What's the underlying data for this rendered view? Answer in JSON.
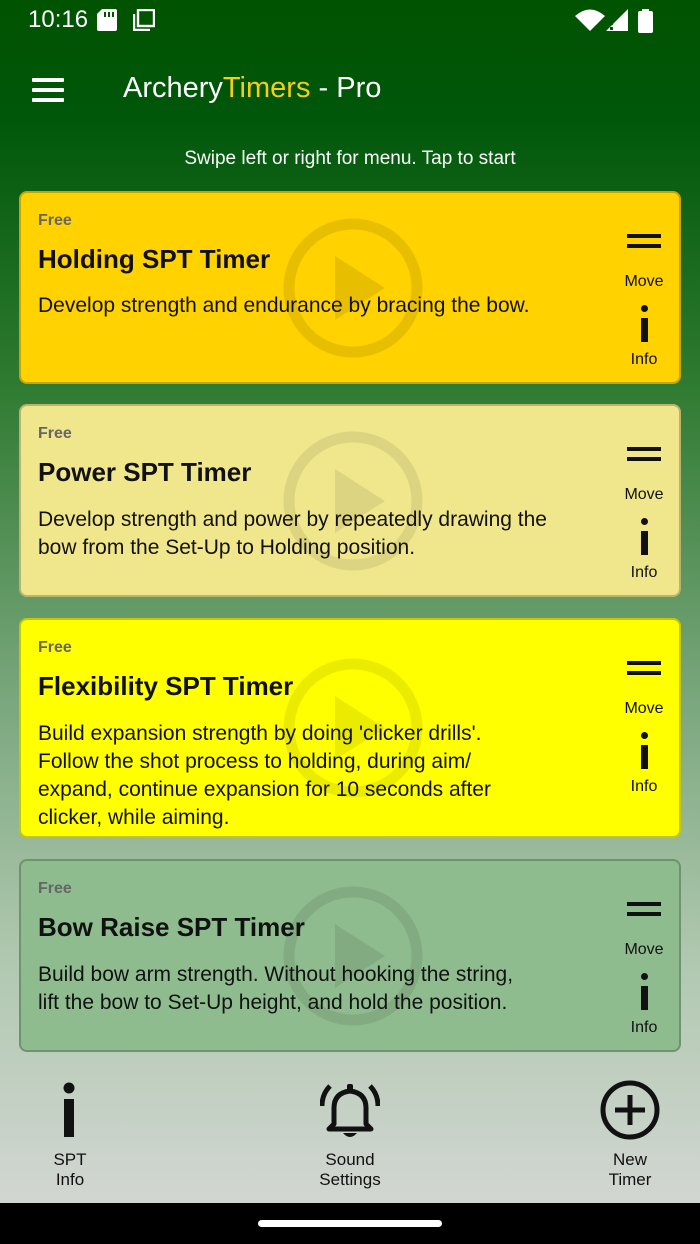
{
  "status_bar": {
    "time": "10:16",
    "icons": [
      "sd-card-icon",
      "screenshot-icon",
      "wifi-icon",
      "signal-icon",
      "battery-icon"
    ]
  },
  "app_bar": {
    "title_part1": "Archery",
    "title_part2": "Timers",
    "title_part3": " - Pro",
    "accent_color": "#f5cc16"
  },
  "hint": "Swipe left or right for menu. Tap to start",
  "cards": [
    {
      "badge": "Free",
      "title": "Holding SPT Timer",
      "desc_lines": [
        "Develop strength and endurance by bracing the bow."
      ],
      "move_label": "Move",
      "info_label": "Info",
      "color": "#ffd200"
    },
    {
      "badge": "Free",
      "title": "Power SPT Timer",
      "desc_lines": [
        "Develop strength and power by repeatedly drawing the",
        "bow from the Set-Up to Holding position."
      ],
      "move_label": "Move",
      "info_label": "Info",
      "color": "#f0e68c"
    },
    {
      "badge": "Free",
      "title": "Flexibility SPT Timer",
      "desc_lines": [
        "Build expansion strength by doing 'clicker drills'.",
        "Follow the shot process to holding, during aim/",
        "expand, continue expansion for 10 seconds after",
        "clicker, while aiming."
      ],
      "move_label": "Move",
      "info_label": "Info",
      "color": "#ffff00"
    },
    {
      "badge": "Free",
      "title": "Bow Raise SPT Timer",
      "desc_lines": [
        "Build bow arm strength. Without hooking the string,",
        "lift the bow to Set-Up height, and hold the position."
      ],
      "move_label": "Move",
      "info_label": "Info",
      "color": "#8fbc8f"
    }
  ],
  "bottom_nav": {
    "spt_info": {
      "line1": "SPT",
      "line2": "Info"
    },
    "sound_settings": {
      "line1": "Sound",
      "line2": "Settings"
    },
    "new_timer": {
      "line1": "New",
      "line2": "Timer"
    }
  }
}
